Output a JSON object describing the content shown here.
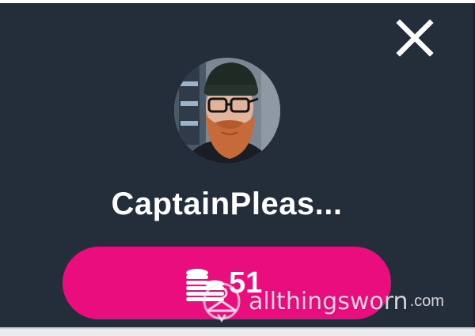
{
  "modal": {
    "username": "CaptainPleas...",
    "coins": {
      "count": "51",
      "button_color": "#ea0d7e"
    },
    "close_icon": "close-icon",
    "avatar_icon": "profile-avatar"
  },
  "watermark": {
    "name": "allthingsworn",
    "tld": ".com"
  },
  "colors": {
    "panel_bg": "#232e3a",
    "accent": "#ea0d7e",
    "text": "#ffffff"
  }
}
